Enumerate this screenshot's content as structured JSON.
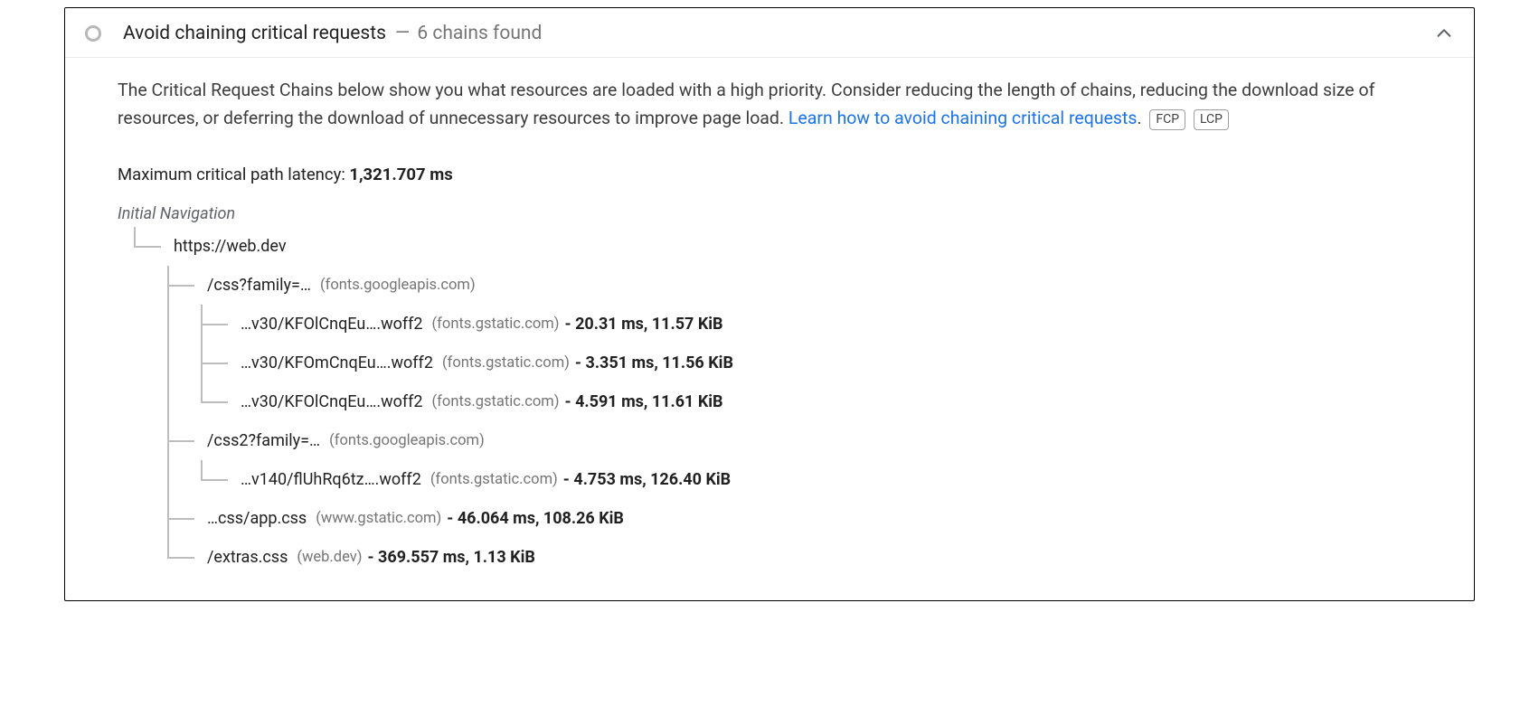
{
  "audit": {
    "title": "Avoid chaining critical requests",
    "separator": "—",
    "summary": "6 chains found",
    "description_before_link": "The Critical Request Chains below show you what resources are loaded with a high priority. Consider reducing the length of chains, reducing the download size of resources, or deferring the download of unnecessary resources to improve page load. ",
    "link_text": "Learn how to avoid chaining critical requests",
    "post_link_period": ".",
    "badges": {
      "fcp": "FCP",
      "lcp": "LCP"
    },
    "latency_label": "Maximum critical path latency: ",
    "latency_value": "1,321.707 ms",
    "initial_nav_label": "Initial Navigation"
  },
  "tree": {
    "root": {
      "url": "https://web.dev"
    },
    "n1": {
      "url": "/css?family=…",
      "host": "(fonts.googleapis.com)"
    },
    "n1_1": {
      "url": "…v30/KFOlCnqEu….woff2",
      "host": "(fonts.gstatic.com)",
      "stats": "- 20.31 ms, 11.57 KiB"
    },
    "n1_2": {
      "url": "…v30/KFOmCnqEu….woff2",
      "host": "(fonts.gstatic.com)",
      "stats": "- 3.351 ms, 11.56 KiB"
    },
    "n1_3": {
      "url": "…v30/KFOlCnqEu….woff2",
      "host": "(fonts.gstatic.com)",
      "stats": "- 4.591 ms, 11.61 KiB"
    },
    "n2": {
      "url": "/css2?family=…",
      "host": "(fonts.googleapis.com)"
    },
    "n2_1": {
      "url": "…v140/flUhRq6tz….woff2",
      "host": "(fonts.gstatic.com)",
      "stats": "- 4.753 ms, 126.40 KiB"
    },
    "n3": {
      "url": "…css/app.css",
      "host": "(www.gstatic.com)",
      "stats": "- 46.064 ms, 108.26 KiB"
    },
    "n4": {
      "url": "/extras.css",
      "host": "(web.dev)",
      "stats": "- 369.557 ms, 1.13 KiB"
    }
  }
}
